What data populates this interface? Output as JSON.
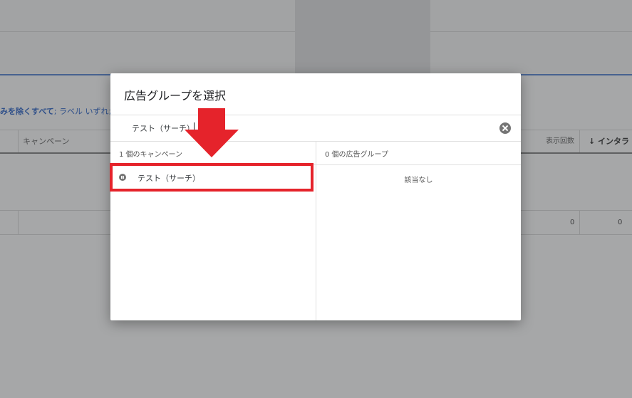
{
  "background": {
    "filter_bold": "みを除くすべて",
    "filter_rest": "; ラベル いずれか",
    "col_campaign": "キャンペーン",
    "col_impressions": "表示回数",
    "col_interactions": "↓ インタラ",
    "row_values": [
      "0",
      "0"
    ]
  },
  "dialog": {
    "title": "広告グループを選択",
    "search_value": "テスト（サーチ）",
    "left_header": "1 個のキャンペーン",
    "right_header": "0 個の広告グループ",
    "campaigns": [
      {
        "label": "テスト（サーチ）",
        "status": "paused"
      }
    ],
    "empty_message": "該当なし"
  },
  "colors": {
    "annotation": "#e5232b",
    "accent_blue": "#4a7bd0"
  },
  "icons": {
    "clear": "clear-icon",
    "campaign_status": "paused-status-icon"
  }
}
